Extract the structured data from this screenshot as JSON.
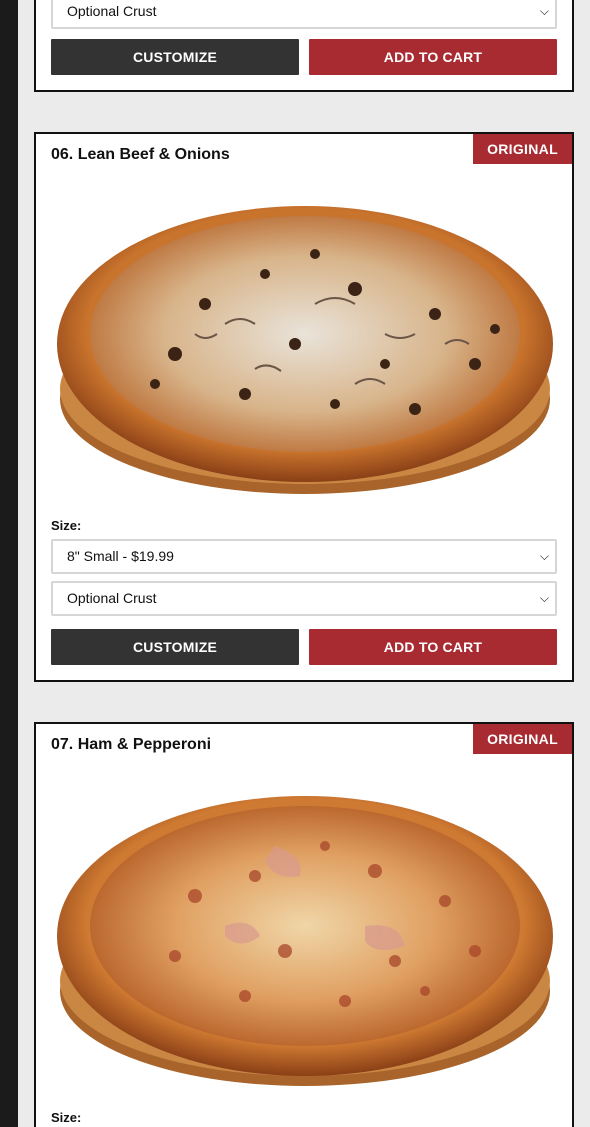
{
  "colors": {
    "accent": "#a92b32",
    "dark_button": "#333333",
    "sidebar": "#1b1b1b"
  },
  "products": [
    {
      "crust_select": "Optional Crust",
      "customize_label": "CUSTOMIZE",
      "add_to_cart_label": "ADD TO CART"
    },
    {
      "badge": "ORIGINAL",
      "title": "06. Lean Beef & Onions",
      "image": "pizza-beef-onions",
      "size_label": "Size:",
      "size_select": "8\" Small - $19.99",
      "crust_select": "Optional Crust",
      "customize_label": "CUSTOMIZE",
      "add_to_cart_label": "ADD TO CART"
    },
    {
      "badge": "ORIGINAL",
      "title": "07. Ham & Pepperoni",
      "image": "pizza-ham-pepperoni",
      "size_label": "Size:"
    }
  ]
}
